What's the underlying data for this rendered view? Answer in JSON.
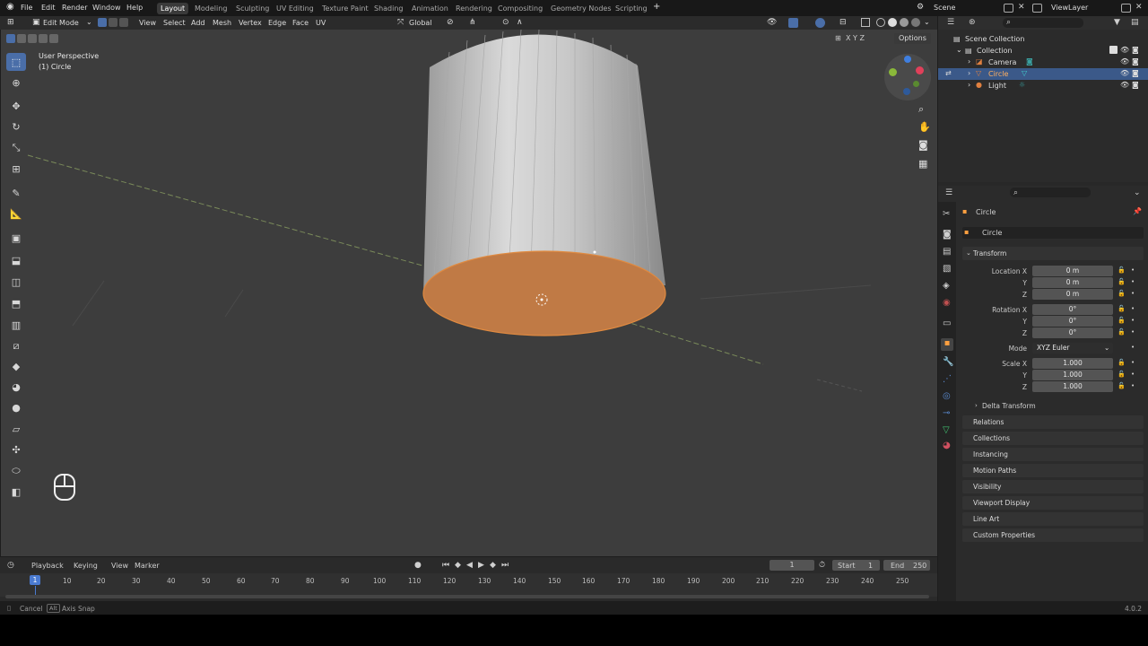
{
  "topmenu": {
    "file": "File",
    "edit": "Edit",
    "render": "Render",
    "window": "Window",
    "help": "Help"
  },
  "workspaces": [
    "Layout",
    "Modeling",
    "Sculpting",
    "UV Editing",
    "Texture Paint",
    "Shading",
    "Animation",
    "Rendering",
    "Compositing",
    "Geometry Nodes",
    "Scripting"
  ],
  "scene": "Scene",
  "viewlayer": "ViewLayer",
  "header": {
    "mode": "Edit Mode",
    "view": "View",
    "select": "Select",
    "add": "Add",
    "mesh": "Mesh",
    "vertex": "Vertex",
    "edge": "Edge",
    "face": "Face",
    "uv": "UV",
    "orientation": "Global",
    "options": "Options",
    "axes": "X Y Z"
  },
  "viewport": {
    "perspective": "User Perspective",
    "object": "(1) Circle"
  },
  "outliner": {
    "scene_collection": "Scene Collection",
    "collection": "Collection",
    "camera": "Camera",
    "circle": "Circle",
    "light": "Light"
  },
  "properties": {
    "object_name": "Circle",
    "data_name": "Circle",
    "transform": "Transform",
    "location_x_label": "Location X",
    "y_label": "Y",
    "z_label": "Z",
    "location": [
      "0 m",
      "0 m",
      "0 m"
    ],
    "rotation_x_label": "Rotation X",
    "rotation": [
      "0°",
      "0°",
      "0°"
    ],
    "mode_label": "Mode",
    "mode_value": "XYZ Euler",
    "scale_x_label": "Scale X",
    "scale": [
      "1.000",
      "1.000",
      "1.000"
    ],
    "delta": "Delta Transform",
    "sections": [
      "Relations",
      "Collections",
      "Instancing",
      "Motion Paths",
      "Visibility",
      "Viewport Display",
      "Line Art",
      "Custom Properties"
    ]
  },
  "timeline": {
    "playback": "Playback",
    "keying": "Keying",
    "view": "View",
    "marker": "Marker",
    "current": "1",
    "start_label": "Start",
    "start": "1",
    "end_label": "End",
    "end": "250",
    "ticks": [
      "10",
      "20",
      "30",
      "40",
      "50",
      "60",
      "70",
      "80",
      "90",
      "100",
      "110",
      "120",
      "130",
      "140",
      "150",
      "160",
      "170",
      "180",
      "190",
      "200",
      "210",
      "220",
      "230",
      "240",
      "250"
    ],
    "frame_marker": "1"
  },
  "status": {
    "cancel": "Cancel",
    "alt": "Alt",
    "axis_snap": "Axis Snap",
    "version": "4.0.2"
  }
}
